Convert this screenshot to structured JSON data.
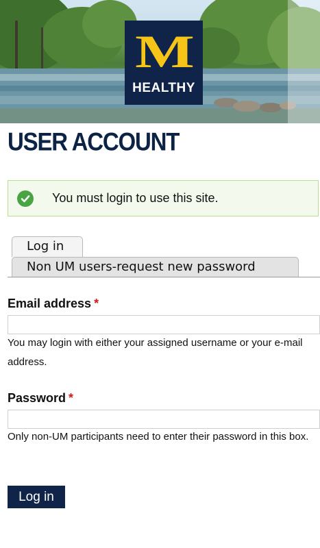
{
  "header": {
    "logo_letter": "M",
    "logo_subtitle": "HEALTHY"
  },
  "page_title": "USER ACCOUNT",
  "status_message": "You must login to use this site.",
  "tabs": [
    {
      "label": "Log in"
    },
    {
      "label": "Non UM users-request new password"
    }
  ],
  "form": {
    "email": {
      "label": "Email address",
      "required_marker": "*",
      "value": "",
      "help": "You may login with either your assigned username or your e-mail address."
    },
    "password": {
      "label": "Password",
      "required_marker": "*",
      "value": "",
      "help": "Only non-UM participants need to enter their password in this box."
    },
    "submit_label": "Log in"
  },
  "colors": {
    "brand_navy": "#0f2448",
    "brand_maize": "#f6c518",
    "status_green": "#4aa444",
    "required_red": "#cc1d1d"
  }
}
